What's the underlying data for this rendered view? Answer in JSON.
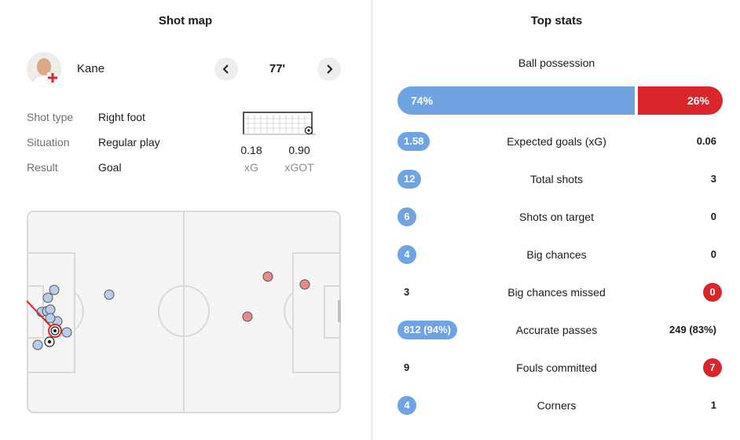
{
  "shot_map": {
    "heading": "Shot map",
    "player": {
      "name": "Kane",
      "minute": "77'"
    },
    "details": [
      {
        "label": "Shot type",
        "value": "Right foot"
      },
      {
        "label": "Situation",
        "value": "Regular play"
      },
      {
        "label": "Result",
        "value": "Goal"
      }
    ],
    "xg": {
      "value": "0.18",
      "label": "xG"
    },
    "xgot": {
      "value": "0.90",
      "label": "xGOT"
    },
    "colors": {
      "home_shot": "#b7cdea",
      "away_shot": "#e88a8a",
      "highlight": "#d8262a",
      "pitch_line": "#d9d9d9",
      "pitch_bg": "#f5f5f5"
    }
  },
  "top_stats": {
    "heading": "Top stats",
    "possession": {
      "label": "Ball possession",
      "home": "74%",
      "away": "26%",
      "home_fraction": 0.74
    },
    "rows": [
      {
        "label": "Expected goals (xG)",
        "home": "1.58",
        "away": "0.06",
        "highlight": "home"
      },
      {
        "label": "Total shots",
        "home": "12",
        "away": "3",
        "highlight": "home"
      },
      {
        "label": "Shots on target",
        "home": "6",
        "away": "0",
        "highlight": "home"
      },
      {
        "label": "Big chances",
        "home": "4",
        "away": "0",
        "highlight": "home"
      },
      {
        "label": "Big chances missed",
        "home": "3",
        "away": "0",
        "highlight": "away"
      },
      {
        "label": "Accurate passes",
        "home": "812 (94%)",
        "away": "249 (83%)",
        "highlight": "home"
      },
      {
        "label": "Fouls committed",
        "home": "9",
        "away": "7",
        "highlight": "away"
      },
      {
        "label": "Corners",
        "home": "4",
        "away": "1",
        "highlight": "home"
      }
    ],
    "colors": {
      "home": "#6fa3e2",
      "away": "#d8262a"
    }
  }
}
